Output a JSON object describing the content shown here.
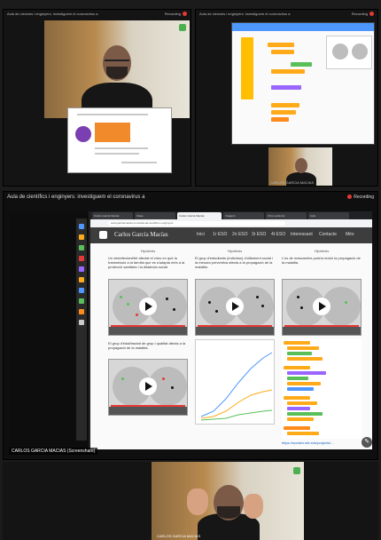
{
  "top_left": {
    "title": "Aula de ciencies i enginyers: investiguem el coronavirus a",
    "rec_label": "Recording"
  },
  "top_right": {
    "title": "Aula de ciencies i enginyers: investiguem el coronavirus a",
    "rec_label": "Recording",
    "participant": "CARLOS GARCIA MACIAS"
  },
  "main": {
    "title": "Aula de científics i enginyers: investiguem el coronavirus a",
    "rec_label": "Recording",
    "browser": {
      "tabs": [
        "Carlos Garcia Macias",
        "Clase",
        "Carlos Garcia Macias",
        "Imagens",
        "Virus epidemic",
        "Aula"
      ],
      "url": "www.garciamacias.com/aula-de-cientifics-i-enginyers"
    },
    "site": {
      "title": "Carlos García Macías",
      "nav": [
        "Inici",
        "1r ESO",
        "2n ESO",
        "3r ESO",
        "4t ESO",
        "Interessant",
        "Contacte",
        "Més"
      ]
    },
    "columns": [
      {
        "heading": "Hipòtesis",
        "text": "Un desinfectant/fet afectat el virus en què la transmissió a la família que es s'adapta més a la protecció sanitària i la distància social."
      },
      {
        "heading": "Hipòtesis",
        "text": "El grup d'estudiants (individus) d'aïllament social i la mesura preventiva afecta a la propagació de la malaltia."
      },
      {
        "heading": "Hipòtesis",
        "text": "L'ús de mascaretes podria reduir la propagació de la malaltia."
      }
    ],
    "column4_text": "El grup d'edat/tractat de grup i qualitat afecta a la propagació de la malaltia.",
    "presenter_tag": "CARLOS GARCIA MACIAS (Screenshare)",
    "link_text": "https://scratch.mit.edu/projects/..."
  },
  "bottom": {
    "participant": "CARLOS GARCIA MACIAS"
  },
  "colors": {
    "accent": "#e53935",
    "scratch_blue": "#4d97ff",
    "scratch_orange": "#ffab19",
    "site_header": "#3d3d3d"
  }
}
